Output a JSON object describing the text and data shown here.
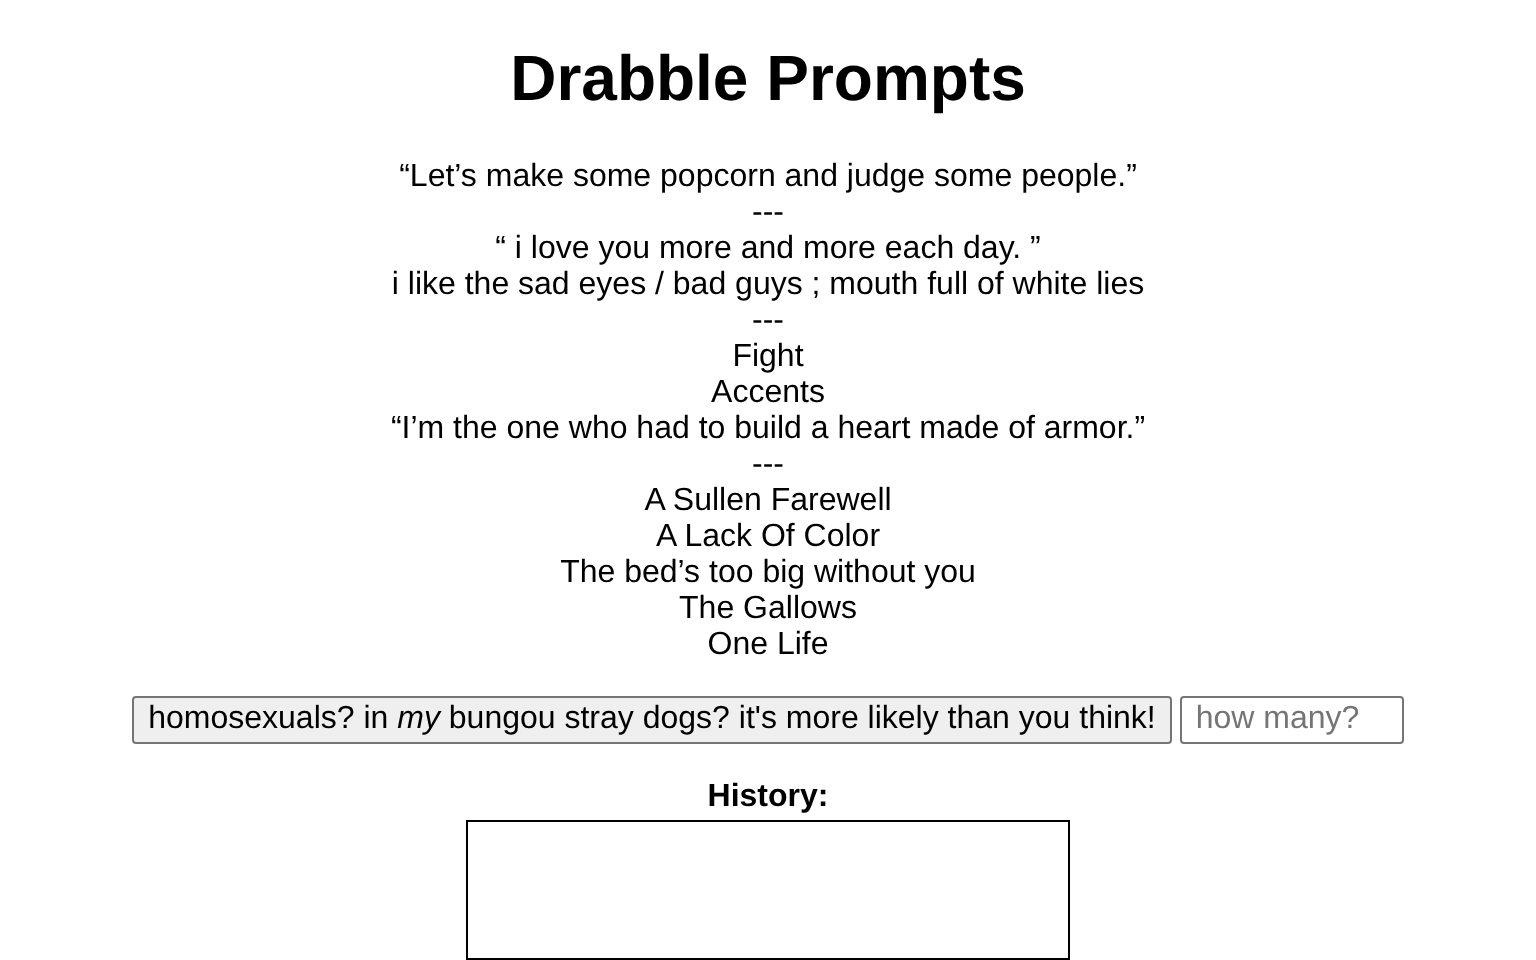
{
  "title": "Drabble Prompts",
  "prompts": [
    "“Let’s make some popcorn and judge some people.”",
    "---",
    "“ i love you more and more each day. ”",
    "i like the sad eyes / bad guys ; mouth full of white lies",
    "---",
    "Fight",
    "Accents",
    "“I’m the one who had to build a heart made of armor.”",
    "---",
    "A Sullen Farewell",
    "A Lack Of Color",
    "The bed’s too big without you",
    "The Gallows",
    "One Life"
  ],
  "generate_button": "homosexuals? in *my* bungou stray dogs? it's more likely than you think!",
  "count_field": {
    "placeholder": "how many?"
  },
  "history": {
    "label": "History:"
  }
}
